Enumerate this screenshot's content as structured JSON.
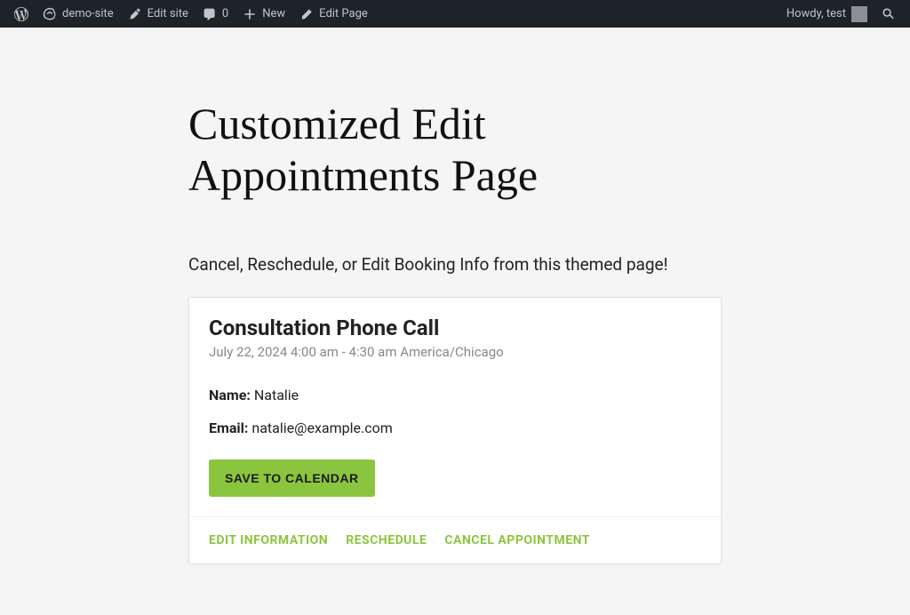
{
  "adminBar": {
    "siteName": "demo-site",
    "editSite": "Edit site",
    "commentsCount": "0",
    "new": "New",
    "editPage": "Edit Page",
    "greeting": "Howdy, test"
  },
  "page": {
    "title": "Customized Edit Appointments Page",
    "subtitle": "Cancel, Reschedule, or Edit Booking Info from this themed page!"
  },
  "appointment": {
    "title": "Consultation Phone Call",
    "datetime": "July 22, 2024 4:00 am - 4:30 am America/Chicago",
    "nameLabel": "Name:",
    "nameValue": "Natalie",
    "emailLabel": "Email:",
    "emailValue": "natalie@example.com",
    "saveButton": "SAVE TO CALENDAR"
  },
  "actions": {
    "editInfo": "EDIT INFORMATION",
    "reschedule": "RESCHEDULE",
    "cancel": "CANCEL APPOINTMENT"
  }
}
